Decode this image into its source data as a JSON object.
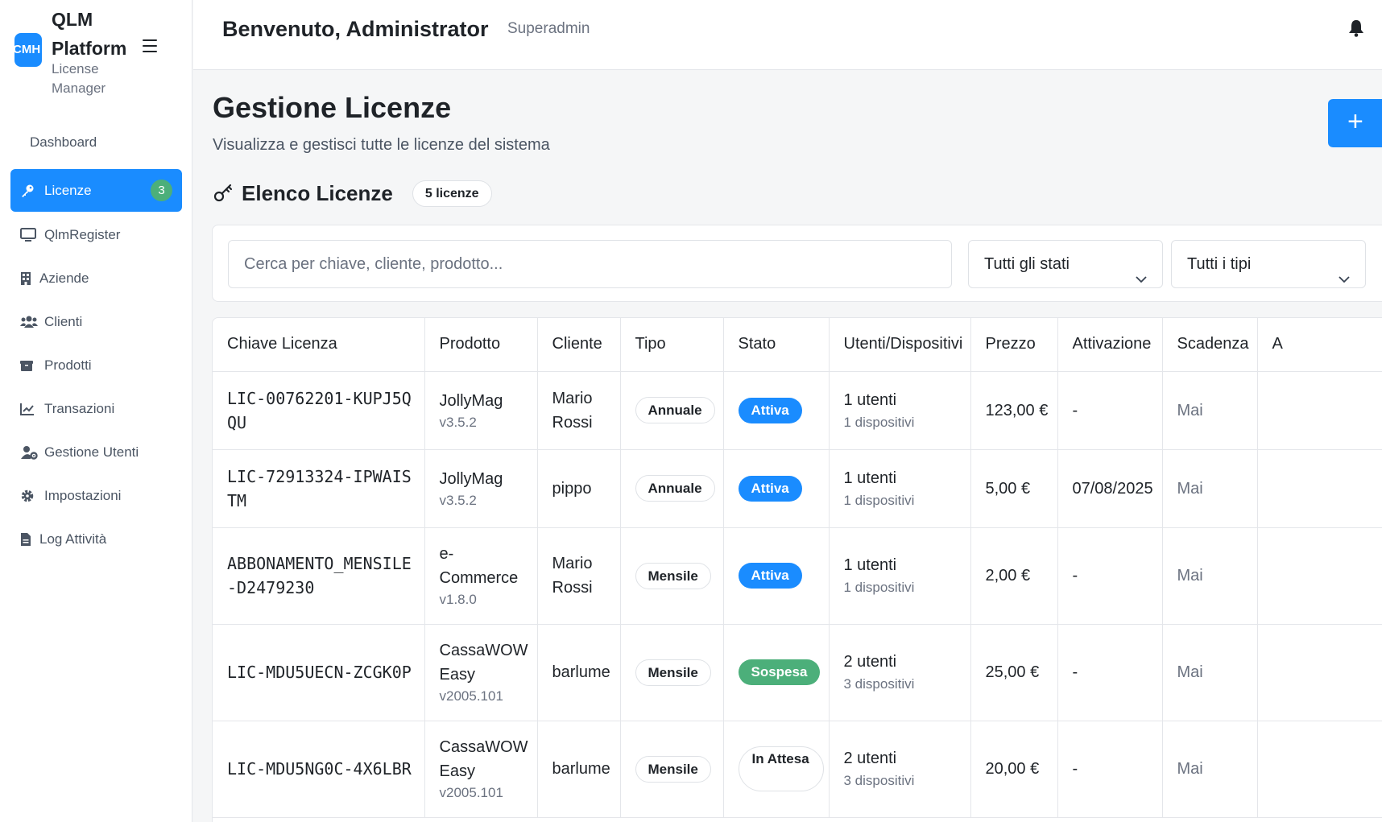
{
  "brand": {
    "logo_text": "CMH",
    "title": "QLM Platform",
    "subtitle": "License Manager"
  },
  "sidebar": {
    "items": [
      {
        "label": "Dashboard",
        "icon": "none"
      },
      {
        "label": "Licenze",
        "icon": "key-icon",
        "badge": "3",
        "active": true
      },
      {
        "label": "QlmRegister",
        "icon": "monitor-icon"
      },
      {
        "label": "Aziende",
        "icon": "building-icon"
      },
      {
        "label": "Clienti",
        "icon": "users-icon"
      },
      {
        "label": "Prodotti",
        "icon": "box-icon"
      },
      {
        "label": "Transazioni",
        "icon": "chart-line-icon"
      },
      {
        "label": "Gestione Utenti",
        "icon": "user-cog-icon"
      },
      {
        "label": "Impostazioni",
        "icon": "gear-icon"
      },
      {
        "label": "Log Attività",
        "icon": "file-icon"
      }
    ]
  },
  "header": {
    "welcome": "Benvenuto, Administrator",
    "role": "Superadmin"
  },
  "main": {
    "title": "Gestione Licenze",
    "subtitle": "Visualizza e gestisci tutte le licenze del sistema",
    "add_label": "+",
    "list_title": "Elenco Licenze",
    "count": "5 licenze"
  },
  "filters": {
    "search_placeholder": "Cerca per chiave, cliente, prodotto...",
    "status_select": "Tutti gli stati",
    "type_select": "Tutti i tipi"
  },
  "table": {
    "columns": [
      "Chiave Licenza",
      "Prodotto",
      "Cliente",
      "Tipo",
      "Stato",
      "Utenti/Dispositivi",
      "Prezzo",
      "Attivazione",
      "Scadenza",
      "A"
    ],
    "rows": [
      {
        "key": "LIC-00762201-KUPJ5QQU",
        "product": "JollyMag",
        "version": "v3.5.2",
        "client": "Mario Rossi",
        "type": "Annuale",
        "status": "Attiva",
        "status_kind": "blue",
        "users": "1 utenti",
        "devices": "1 dispositivi",
        "price": "123,00 €",
        "activation": "-",
        "expiry": "Mai"
      },
      {
        "key": "LIC-72913324-IPWAISTM",
        "product": "JollyMag",
        "version": "v3.5.2",
        "client": "pippo",
        "type": "Annuale",
        "status": "Attiva",
        "status_kind": "blue",
        "users": "1 utenti",
        "devices": "1 dispositivi",
        "price": "5,00 €",
        "activation": "07/08/2025",
        "expiry": "Mai"
      },
      {
        "key": "ABBONAMENTO_MENSILE-D2479230",
        "product": "e-Commerce",
        "version": "v1.8.0",
        "client": "Mario Rossi",
        "type": "Mensile",
        "status": "Attiva",
        "status_kind": "blue",
        "users": "1 utenti",
        "devices": "1 dispositivi",
        "price": "2,00 €",
        "activation": "-",
        "expiry": "Mai"
      },
      {
        "key": "LIC-MDU5UECN-ZCGK0P",
        "product": "CassaWOW Easy",
        "version": "v2005.101",
        "client": "barlume",
        "type": "Mensile",
        "status": "Sospesa",
        "status_kind": "green",
        "users": "2 utenti",
        "devices": "3 dispositivi",
        "price": "25,00 €",
        "activation": "-",
        "expiry": "Mai"
      },
      {
        "key": "LIC-MDU5NG0C-4X6LBR",
        "product": "CassaWOW Easy",
        "version": "v2005.101",
        "client": "barlume",
        "type": "Mensile",
        "status": "In Attesa",
        "status_kind": "wait",
        "users": "2 utenti",
        "devices": "3 dispositivi",
        "price": "20,00 €",
        "activation": "-",
        "expiry": "Mai"
      }
    ]
  },
  "colors": {
    "accent": "#1a8cff",
    "success": "#4caf7a",
    "muted_text": "#6b7280",
    "border": "#e4e6ea"
  }
}
